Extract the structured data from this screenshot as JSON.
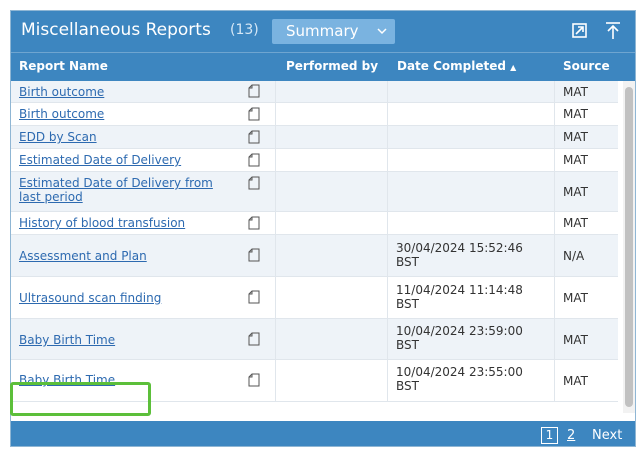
{
  "header": {
    "title": "Miscellaneous Reports",
    "count": "(13)",
    "view_select": "Summary"
  },
  "columns": {
    "report_name": "Report Name",
    "performed_by": "Performed by",
    "date_completed": "Date Completed",
    "sort_indicator": "▲",
    "source": "Source"
  },
  "rows": [
    {
      "name": "Birth outcome",
      "performed_by": "",
      "date": "",
      "date_tz": "",
      "source": "MAT"
    },
    {
      "name": "Birth outcome",
      "performed_by": "",
      "date": "",
      "date_tz": "",
      "source": "MAT"
    },
    {
      "name": "EDD by Scan",
      "performed_by": "",
      "date": "",
      "date_tz": "",
      "source": "MAT"
    },
    {
      "name": "Estimated Date of Delivery",
      "performed_by": "",
      "date": "",
      "date_tz": "",
      "source": "MAT"
    },
    {
      "name": "Estimated Date of Delivery from",
      "name_line2": "last period",
      "performed_by": "",
      "date": "",
      "date_tz": "",
      "source": "MAT"
    },
    {
      "name": "History of blood transfusion",
      "performed_by": "",
      "date": "",
      "date_tz": "",
      "source": "MAT"
    },
    {
      "name": "Assessment and Plan",
      "performed_by": "",
      "date": "30/04/2024 15:52:46",
      "date_tz": "BST",
      "source": "N/A"
    },
    {
      "name": "Ultrasound scan finding",
      "performed_by": "",
      "date": "11/04/2024 11:14:48",
      "date_tz": "BST",
      "source": "MAT"
    },
    {
      "name": "Baby Birth Time",
      "performed_by": "",
      "date": "10/04/2024 23:59:00",
      "date_tz": "BST",
      "source": "MAT"
    },
    {
      "name": "Baby Birth Time",
      "performed_by": "",
      "date": "10/04/2024 23:55:00",
      "date_tz": "BST",
      "source": "MAT"
    }
  ],
  "pagination": {
    "page1": "1",
    "page2": "2",
    "next": "Next"
  },
  "icons": {
    "popout": "popout-icon",
    "collapse": "collapse-up-icon",
    "document": "document-icon",
    "dropdown": "chevron-down-icon"
  },
  "colors": {
    "header_bg": "#3d86c0",
    "link": "#2d6ab0",
    "highlight": "#5cbf3a"
  }
}
